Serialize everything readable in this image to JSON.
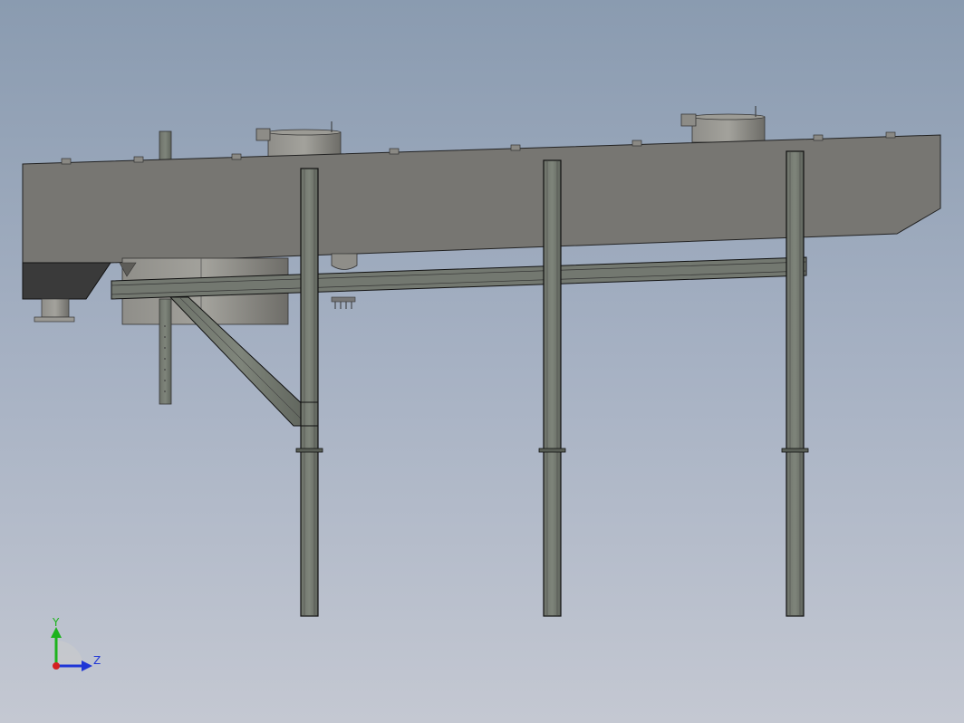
{
  "viewport": {
    "background_top": "#8a9bb0",
    "background_bottom": "#c4c8d2"
  },
  "model": {
    "body_color": "#777672",
    "steel_color": "#737870",
    "dark_color": "#3a3a3a",
    "edge_color": "#000000"
  },
  "triad": {
    "y_label": "Y",
    "z_label": "Z",
    "y_color": "#1db31d",
    "z_color": "#1f35d6",
    "x_color": "#d42020"
  }
}
